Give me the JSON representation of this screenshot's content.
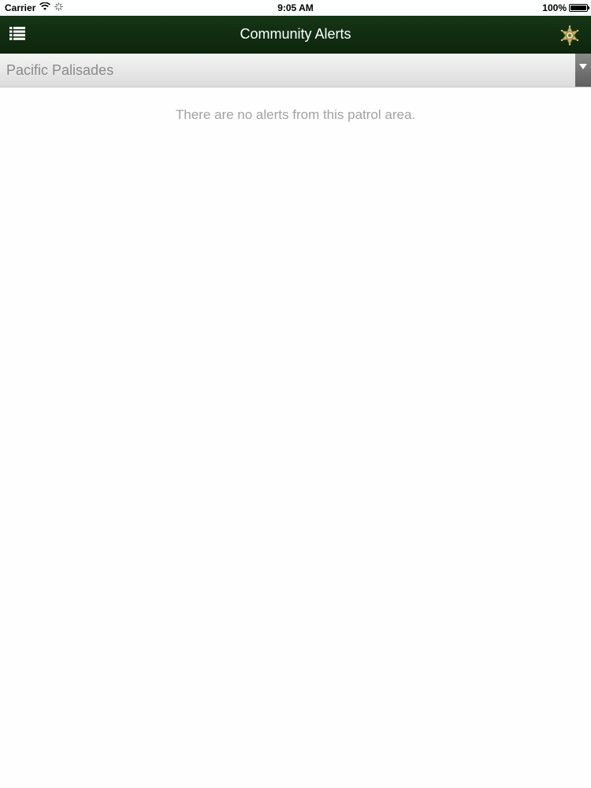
{
  "status_bar": {
    "carrier": "Carrier",
    "time": "9:05 AM",
    "battery": "100%",
    "battery_level": 1.0
  },
  "nav": {
    "title": "Community Alerts",
    "menu_icon": "list-icon",
    "badge_icon": "sheriff-star-icon",
    "background_color": "#143114"
  },
  "area_select": {
    "selected": "Pacific Palisades"
  },
  "alerts": {
    "empty_message": "There are no alerts from this patrol area."
  }
}
